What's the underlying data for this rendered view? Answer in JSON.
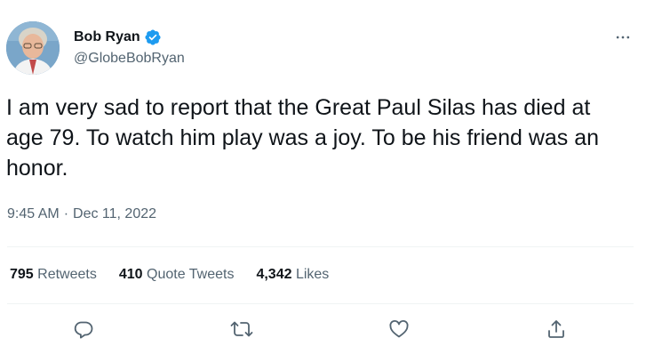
{
  "author": {
    "display_name": "Bob Ryan",
    "handle": "@GlobeBobRyan",
    "verified": true
  },
  "tweet": {
    "text": "I am very sad to report that the Great Paul Silas has died at age 79. To watch him play was a joy. To be his friend was an honor.",
    "time": "9:45 AM",
    "separator": "·",
    "date": "Dec 11, 2022"
  },
  "stats": {
    "retweets": {
      "count": "795",
      "label": "Retweets"
    },
    "quote_tweets": {
      "count": "410",
      "label": "Quote Tweets"
    },
    "likes": {
      "count": "4,342",
      "label": "Likes"
    }
  },
  "icons": {
    "more": "more-horizontal-icon",
    "verified": "verified-badge-icon",
    "reply": "reply-icon",
    "retweet": "retweet-icon",
    "like": "heart-icon",
    "share": "share-icon"
  },
  "colors": {
    "verified_blue": "#1d9bf0",
    "text_primary": "#0f1419",
    "text_secondary": "#536471",
    "divider": "#eff3f4"
  }
}
